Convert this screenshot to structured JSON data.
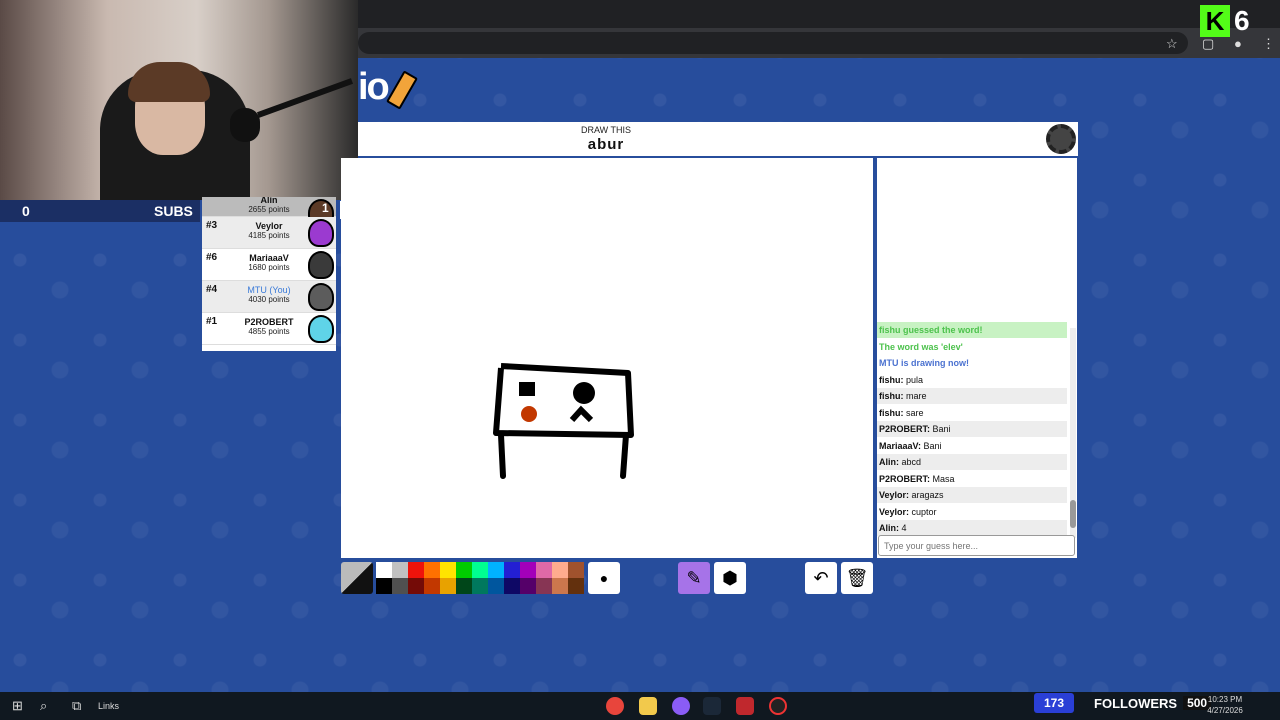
{
  "stream": {
    "subs_count": "0",
    "subs_label": "SUBS",
    "kick_number": "6",
    "followers_count": "173",
    "followers_label": "FOLLOWERS",
    "followers_goal": "500"
  },
  "game": {
    "logo_text": "io",
    "draw_label": "DRAW THIS",
    "word": "abur"
  },
  "players": [
    {
      "rank": "",
      "name": "Alin",
      "points": "2655 points",
      "avatar_color": "#5b3a26",
      "partial": true,
      "badge": "1"
    },
    {
      "rank": "#3",
      "name": "Veylor",
      "points": "4185 points",
      "avatar_color": "#9b3ad0"
    },
    {
      "rank": "#6",
      "name": "MariaaaV",
      "points": "1680 points",
      "avatar_color": "#3a3a3a"
    },
    {
      "rank": "#4",
      "name": "MTU (You)",
      "points": "4030 points",
      "avatar_color": "#5c5c5c",
      "you": true
    },
    {
      "rank": "#1",
      "name": "P2ROBERT",
      "points": "4855 points",
      "avatar_color": "#5fd3e8"
    }
  ],
  "side_count": "4",
  "chat": {
    "messages": [
      {
        "text": "fishu guessed the word!",
        "style": "gb"
      },
      {
        "text": "The word was 'elev'",
        "style": "g"
      },
      {
        "text": "MTU is drawing now!",
        "style": "bl"
      },
      {
        "user": "fishu:",
        "text": " pula"
      },
      {
        "user": "fishu:",
        "text": " mare"
      },
      {
        "user": "fishu:",
        "text": " sare"
      },
      {
        "user": "P2ROBERT:",
        "text": " Bani"
      },
      {
        "user": "MariaaaV:",
        "text": " Bani"
      },
      {
        "user": "Alin:",
        "text": " abcd"
      },
      {
        "user": "P2ROBERT:",
        "text": " Masa"
      },
      {
        "user": "Veylor:",
        "text": " aragazs"
      },
      {
        "user": "Veylor:",
        "text": " cuptor"
      },
      {
        "user": "Alin:",
        "text": " 4"
      }
    ],
    "placeholder": "Type your guess here..."
  },
  "palette": [
    "#ffffff",
    "#c1c1c1",
    "#ef130b",
    "#ff7100",
    "#ffe400",
    "#00cc00",
    "#00ff91",
    "#00b2ff",
    "#231fd3",
    "#a300ba",
    "#df69a7",
    "#ffac8e",
    "#a0522d",
    "#000000",
    "#505050",
    "#740b07",
    "#c23800",
    "#e8a200",
    "#004619",
    "#00785d",
    "#00569e",
    "#0e0865",
    "#550069",
    "#873554",
    "#cc774d",
    "#63300d"
  ],
  "tools": {
    "brush_key": "B",
    "fill_key": "F",
    "undo_key": "U",
    "clear_key": "C"
  },
  "taskbar": {
    "links_label": "Links",
    "time": "10:23 PM",
    "date": "4/27/2026"
  }
}
